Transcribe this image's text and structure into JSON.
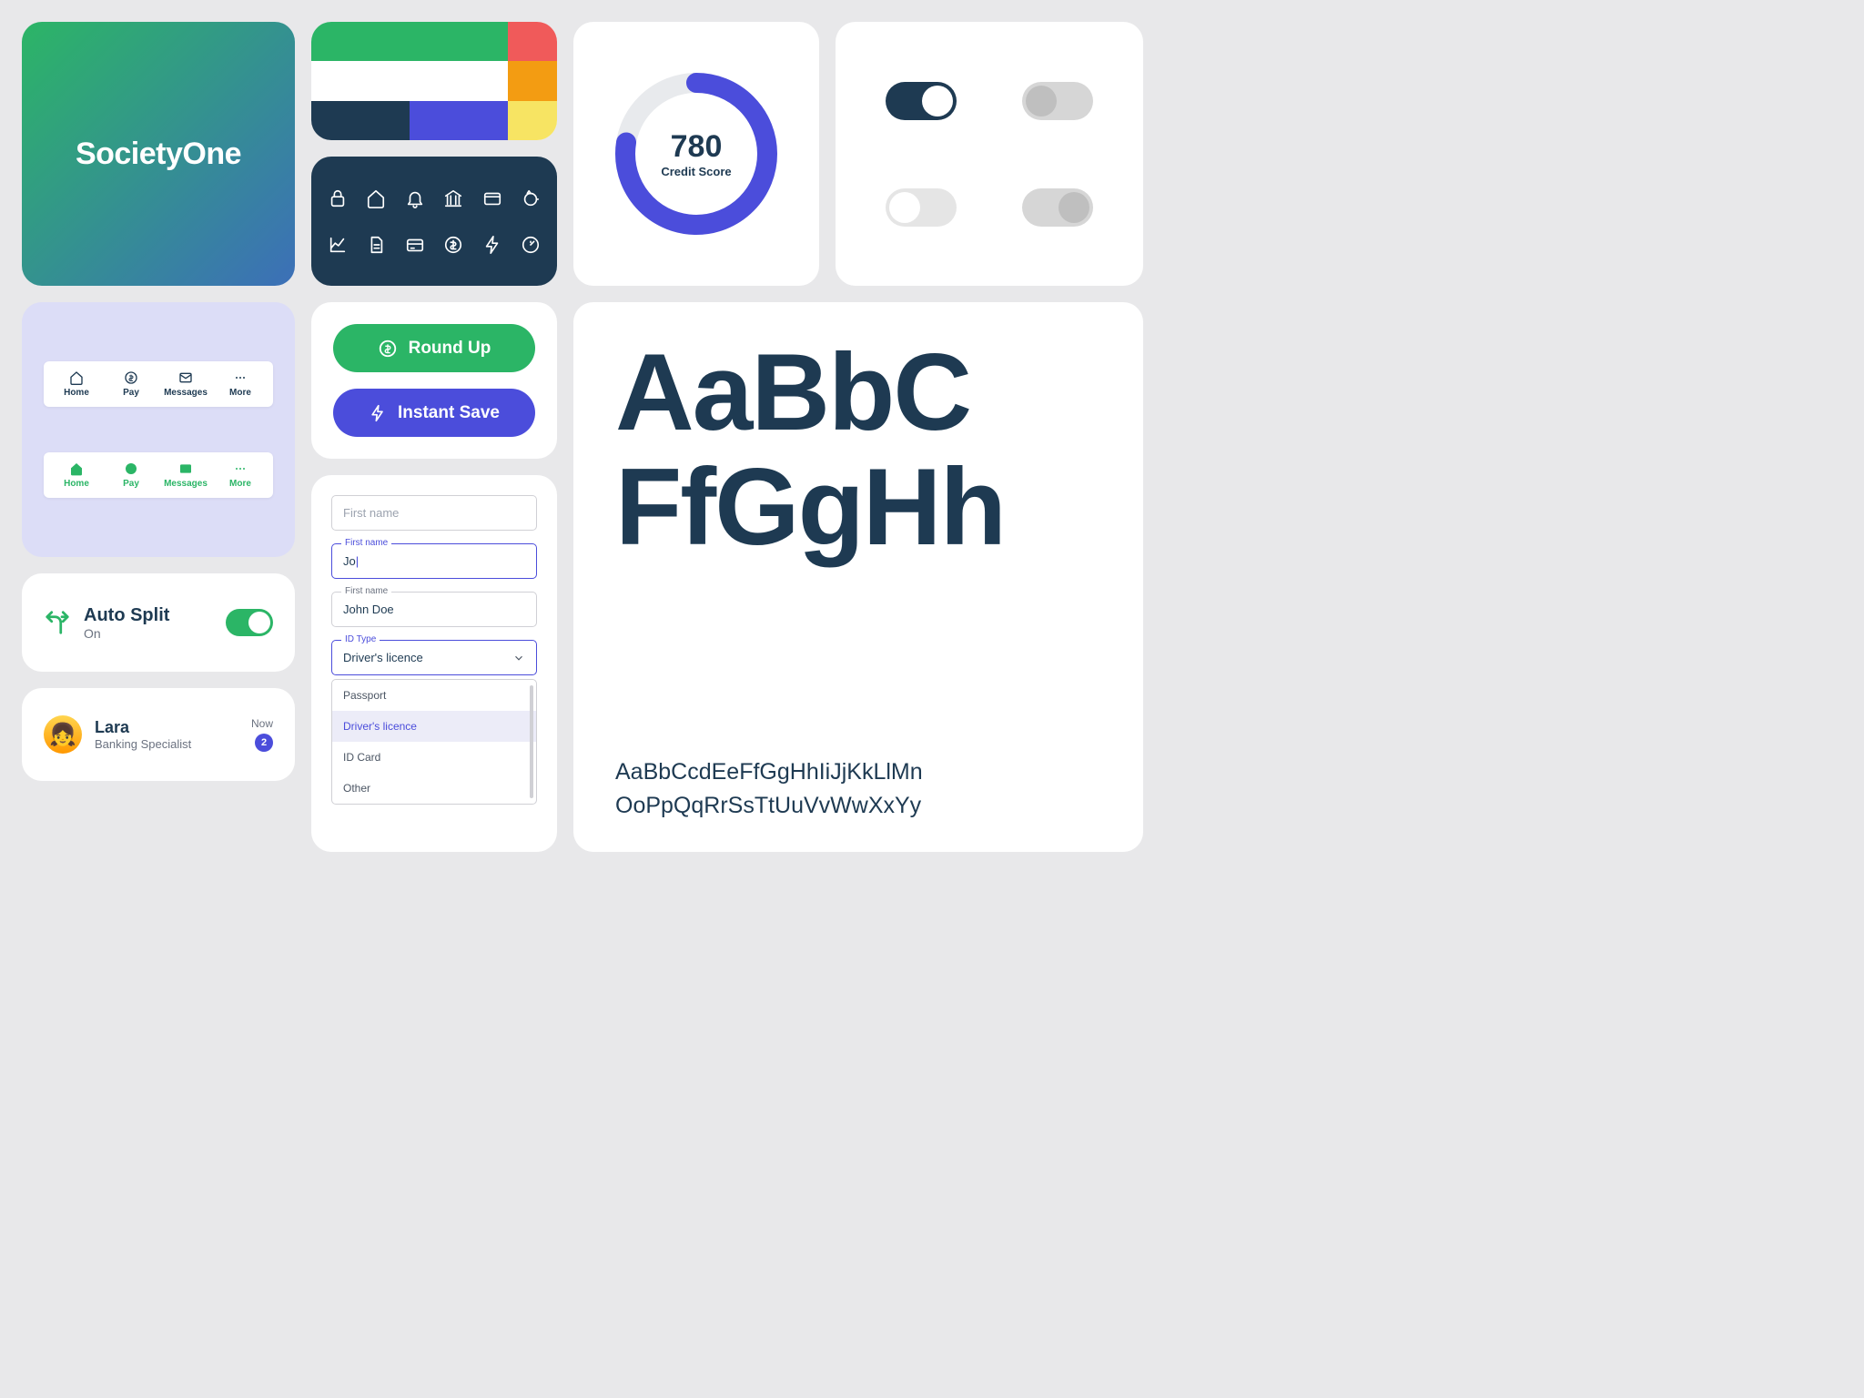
{
  "logo": {
    "text": "SocietyOne"
  },
  "palette": {
    "row1": [
      "#2bb566",
      "#f05a5a"
    ],
    "row2": [
      "#ffffff",
      "#f39c12"
    ],
    "row3": [
      "#1e3a52",
      "#4b4ddb",
      "#f7e463"
    ]
  },
  "icons": [
    "lock",
    "home",
    "bell",
    "bank",
    "card",
    "piggy",
    "graph",
    "doc",
    "card2",
    "dollar-cycle",
    "bolt",
    "gauge"
  ],
  "gauge": {
    "value": "780",
    "label": "Credit Score"
  },
  "nav": {
    "items": [
      {
        "label": "Home"
      },
      {
        "label": "Pay"
      },
      {
        "label": "Messages"
      },
      {
        "label": "More"
      }
    ]
  },
  "buttons": {
    "round_up": "Round Up",
    "instant_save": "Instant Save"
  },
  "auto_split": {
    "title": "Auto Split",
    "status": "On"
  },
  "chat": {
    "name": "Lara",
    "role": "Banking Specialist",
    "time": "Now",
    "unread": "2"
  },
  "forms": {
    "f1_label": "First name",
    "f2_label": "First name",
    "f2_value": "Jo",
    "f3_label": "First name",
    "f3_value": "John Doe",
    "sel_label": "ID Type",
    "sel_value": "Driver's licence",
    "options": [
      "Passport",
      "Driver's licence",
      "ID Card",
      "Other"
    ]
  },
  "typography": {
    "big1": "AaBbC",
    "big2": "FfGgHh",
    "line1": "AaBbCcdEeFfGgHhIiJjKkLlMn",
    "line2": "OoPpQqRrSsTtUuVvWwXxYy"
  }
}
